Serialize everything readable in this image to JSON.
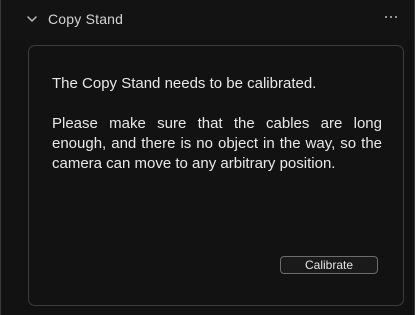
{
  "panel": {
    "title": "Copy Stand",
    "message_title": "The Copy Stand needs to be calibrated.",
    "message_body": "Please make sure that the cables are long enough, and there is no object in the way, so the camera can move to any arbitrary position.",
    "calibrate_label": "Calibrate"
  },
  "icons": {
    "collapse": "chevron-down-icon",
    "more": "ellipsis-icon"
  },
  "colors": {
    "background": "#121212",
    "panel_border": "#3d3d3d",
    "text": "#e8e8e8",
    "button_border": "#6c6c6c"
  }
}
